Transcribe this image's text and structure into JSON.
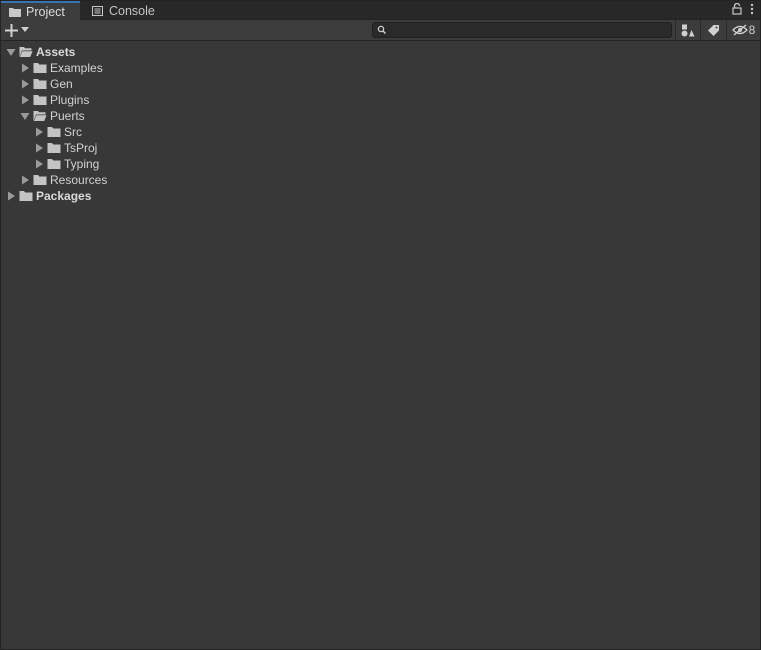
{
  "tabs": [
    {
      "label": "Project",
      "icon": "folder-icon",
      "active": true
    },
    {
      "label": "Console",
      "icon": "console-icon",
      "active": false
    }
  ],
  "toolbar": {
    "create_icon": "plus-icon",
    "search_value": "",
    "search_placeholder": "",
    "hidden_count": "8"
  },
  "tree": [
    {
      "label": "Assets",
      "depth": 0,
      "expanded": true,
      "has_children": true,
      "bold": true
    },
    {
      "label": "Examples",
      "depth": 1,
      "expanded": false,
      "has_children": true
    },
    {
      "label": "Gen",
      "depth": 1,
      "expanded": false,
      "has_children": true
    },
    {
      "label": "Plugins",
      "depth": 1,
      "expanded": false,
      "has_children": true
    },
    {
      "label": "Puerts",
      "depth": 1,
      "expanded": true,
      "has_children": true
    },
    {
      "label": "Src",
      "depth": 2,
      "expanded": false,
      "has_children": true
    },
    {
      "label": "TsProj",
      "depth": 2,
      "expanded": false,
      "has_children": true
    },
    {
      "label": "Typing",
      "depth": 2,
      "expanded": false,
      "has_children": true
    },
    {
      "label": "Resources",
      "depth": 1,
      "expanded": false,
      "has_children": true
    },
    {
      "label": "Packages",
      "depth": 0,
      "expanded": false,
      "has_children": true,
      "bold": true
    }
  ],
  "colors": {
    "background": "#383838",
    "tab_active_accent": "#3a72b0",
    "text": "#d2d2d2"
  }
}
